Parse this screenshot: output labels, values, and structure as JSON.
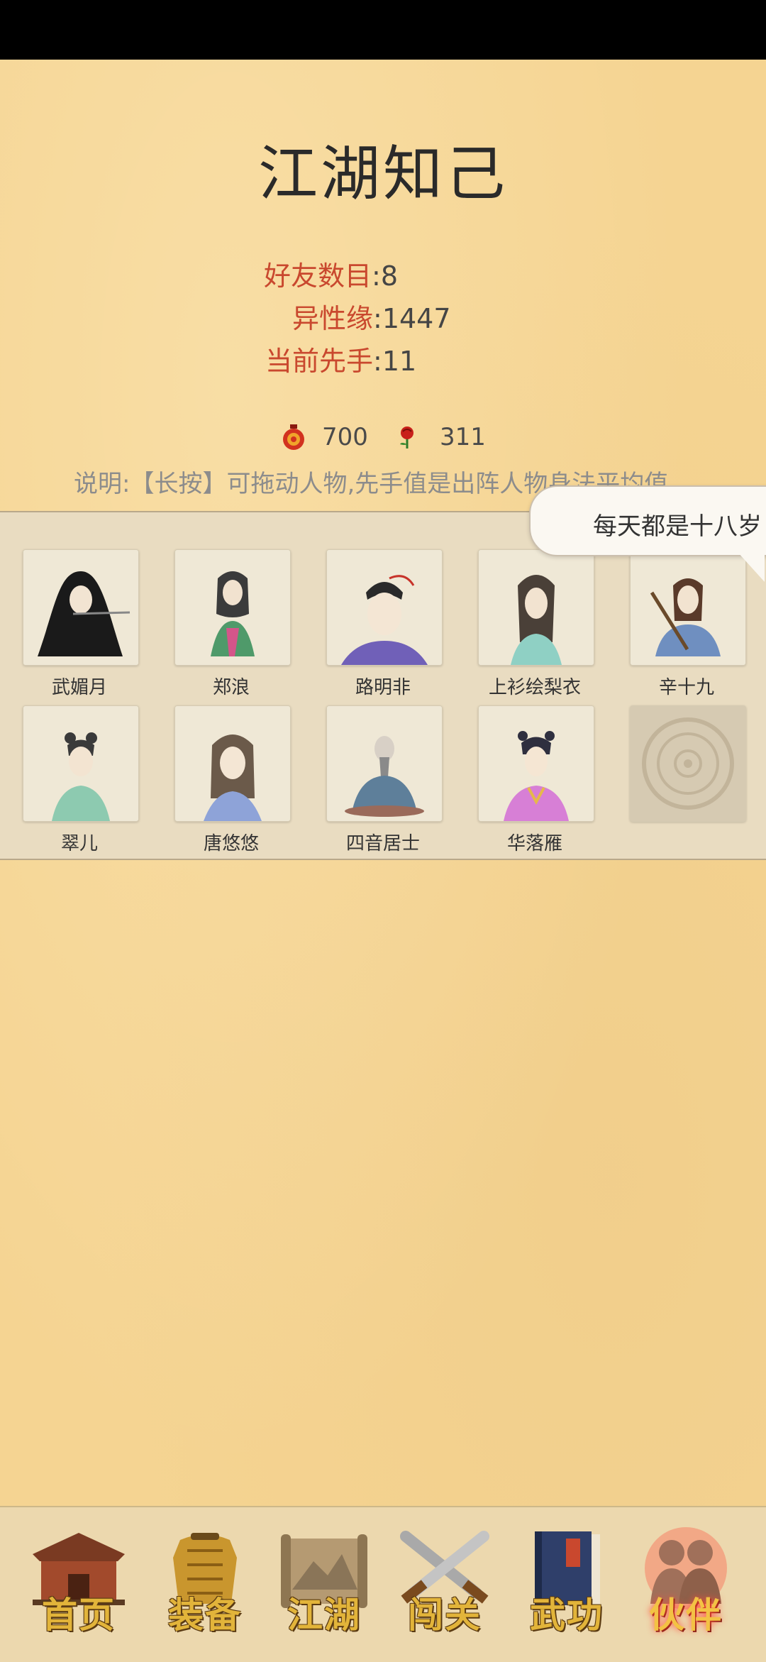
{
  "page": {
    "title": "江湖知己",
    "stats": [
      {
        "label": "好友数目",
        "value": ":8"
      },
      {
        "label": "异性缘",
        "value": ":1447"
      },
      {
        "label": "当前先手",
        "value": ":11"
      }
    ],
    "resources": {
      "gourd": {
        "icon": "red-gourd-icon",
        "value": "700"
      },
      "rose": {
        "icon": "rose-icon",
        "value": "311"
      }
    },
    "note": "说明:【长按】可拖动人物,先手值是出阵人物身法平均值",
    "bubble": "每天都是十八岁"
  },
  "characters": [
    {
      "name": "武媚月"
    },
    {
      "name": "郑浪"
    },
    {
      "name": "路明非"
    },
    {
      "name": "上衫绘梨衣"
    },
    {
      "name": "辛十九"
    },
    {
      "name": "翠儿"
    },
    {
      "name": "唐悠悠"
    },
    {
      "name": "四音居士"
    },
    {
      "name": "华落雁"
    }
  ],
  "empty_slot": {
    "icon": "bronze-seal-icon"
  },
  "tabs": [
    {
      "label": "首页",
      "icon": "house-icon",
      "active": false
    },
    {
      "label": "装备",
      "icon": "armor-icon",
      "active": false
    },
    {
      "label": "江湖",
      "icon": "scroll-map-icon",
      "active": false
    },
    {
      "label": "闯关",
      "icon": "crossed-swords-icon",
      "active": false
    },
    {
      "label": "武功",
      "icon": "book-icon",
      "active": false
    },
    {
      "label": "伙伴",
      "icon": "partners-icon",
      "active": true
    }
  ],
  "colors": {
    "background": "#f5d492",
    "accent_label": "#c9482e",
    "panel": "#e9dcc1"
  }
}
